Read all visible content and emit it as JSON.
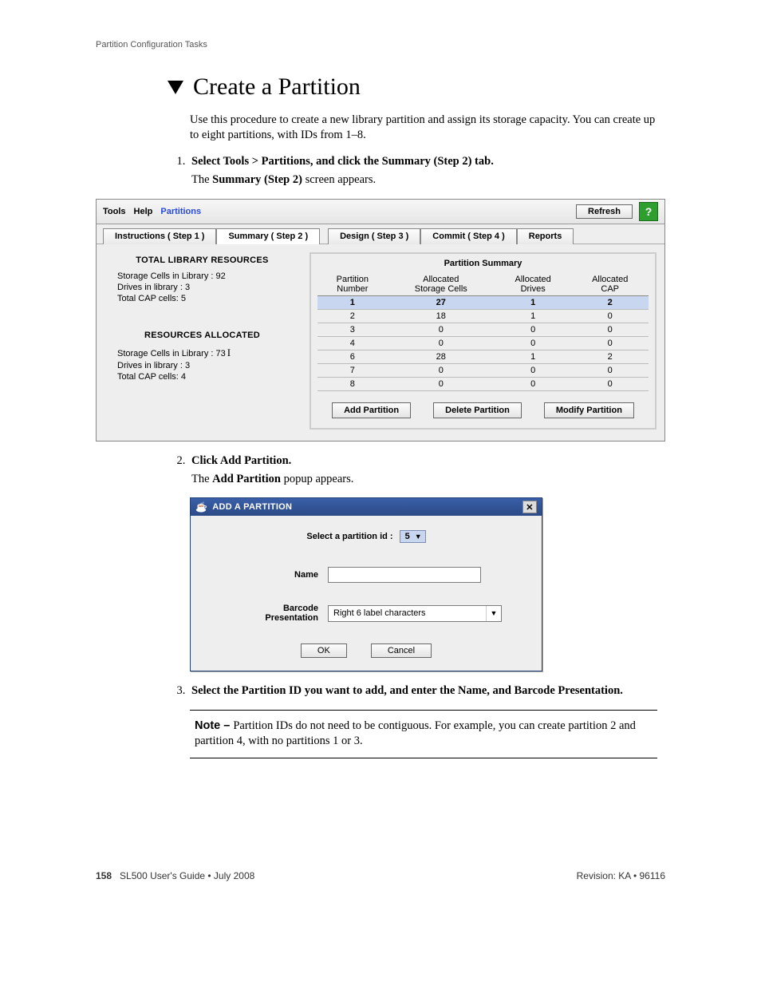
{
  "header_section": "Partition Configuration Tasks",
  "page_title": "Create a Partition",
  "intro": "Use this procedure to create a new library partition and assign its storage capacity. You can create up to eight partitions, with IDs from 1–8.",
  "steps": [
    {
      "title": "Select Tools > Partitions, and click the Summary (Step 2) tab.",
      "desc_prefix": "The ",
      "desc_bold": "Summary (Step 2)",
      "desc_suffix": " screen appears."
    },
    {
      "title": "Click Add Partition.",
      "desc_prefix": "The ",
      "desc_bold": "Add Partition",
      "desc_suffix": " popup appears."
    },
    {
      "title": "Select the Partition ID you want to add, and enter the Name, and Barcode Presentation.",
      "desc_prefix": "",
      "desc_bold": "",
      "desc_suffix": ""
    }
  ],
  "app": {
    "menu": {
      "tools": "Tools",
      "help": "Help",
      "partitions": "Partitions"
    },
    "refresh": "Refresh",
    "help_icon": "?",
    "tabs": [
      "Instructions ( Step 1 )",
      "Summary ( Step 2 )",
      "Design ( Step 3 )",
      "Commit ( Step 4 )",
      "Reports"
    ],
    "left": {
      "h1": "TOTAL LIBRARY RESOURCES",
      "l1": "Storage Cells in Library : 92",
      "l2": "Drives in library : 3",
      "l3": "Total CAP cells: 5",
      "h2": "RESOURCES ALLOCATED",
      "l4": "Storage Cells in Library : 73",
      "l5": "Drives in library : 3",
      "l6": "Total CAP cells: 4"
    },
    "summary_title": "Partition Summary",
    "cols": {
      "c1a": "Partition",
      "c1b": "Number",
      "c2a": "Allocated",
      "c2b": "Storage Cells",
      "c3a": "Allocated",
      "c3b": "Drives",
      "c4a": "Allocated",
      "c4b": "CAP"
    },
    "rows": [
      {
        "n": "1",
        "s": "27",
        "d": "1",
        "c": "2",
        "sel": true
      },
      {
        "n": "2",
        "s": "18",
        "d": "1",
        "c": "0"
      },
      {
        "n": "3",
        "s": "0",
        "d": "0",
        "c": "0"
      },
      {
        "n": "4",
        "s": "0",
        "d": "0",
        "c": "0"
      },
      {
        "n": "6",
        "s": "28",
        "d": "1",
        "c": "2"
      },
      {
        "n": "7",
        "s": "0",
        "d": "0",
        "c": "0"
      },
      {
        "n": "8",
        "s": "0",
        "d": "0",
        "c": "0"
      }
    ],
    "btns": {
      "add": "Add Partition",
      "del": "Delete Partition",
      "mod": "Modify Partition"
    }
  },
  "popup": {
    "title": "ADD A PARTITION",
    "select_label": "Select a partition id :",
    "select_value": "5",
    "name_label": "Name",
    "barcode_label_a": "Barcode",
    "barcode_label_b": "Presentation",
    "barcode_value": "Right 6 label characters",
    "ok": "OK",
    "cancel": "Cancel"
  },
  "note": {
    "label": "Note – ",
    "text": "Partition IDs do not need to be contiguous. For example, you can create partition 2 and partition 4, with no partitions 1 or 3."
  },
  "footer": {
    "page": "158",
    "left": "SL500 User's Guide • July 2008",
    "right": "Revision: KA • 96116"
  }
}
